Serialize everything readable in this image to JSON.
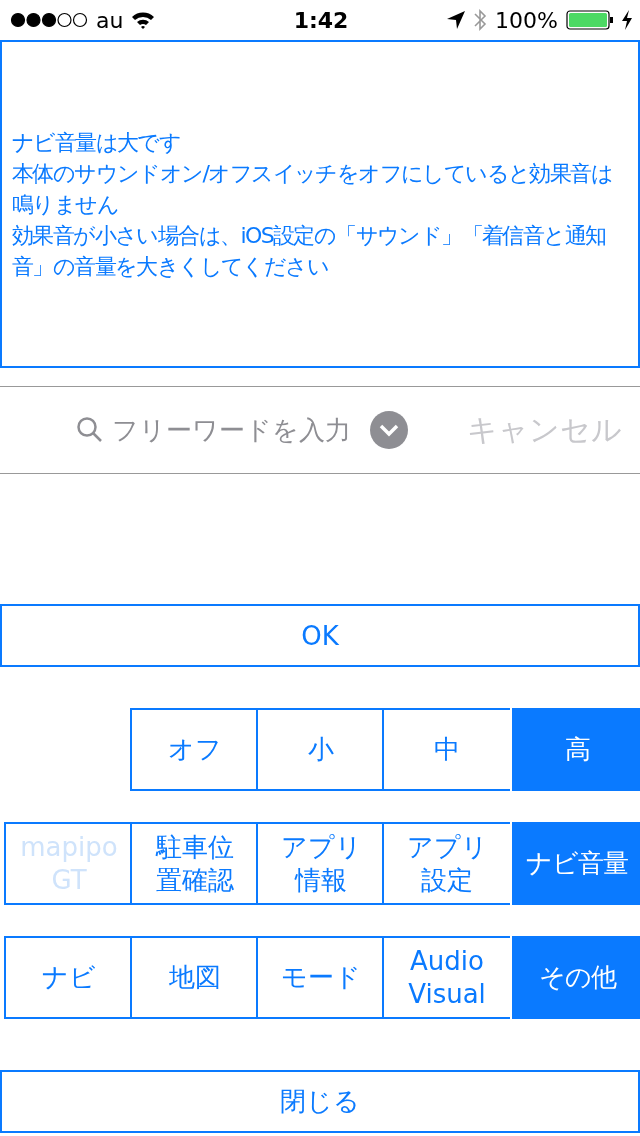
{
  "status_bar": {
    "carrier": "au",
    "time": "1:42",
    "battery": "100%"
  },
  "message": {
    "lines": [
      "ナビ音量は大です",
      "本体のサウンドオン/オフスイッチをオフにしていると効果音は鳴りません",
      "効果音が小さい場合は、iOS設定の「サウンド」「着信音と通知音」の音量を大きくしてください"
    ]
  },
  "search": {
    "placeholder": "フリーワードを入力",
    "cancel": {
      "label": "キャンセル",
      "disabled": true
    }
  },
  "ok_button": "OK",
  "menu_rows": [
    [
      {
        "label": "オフ",
        "selected": false,
        "disabled": false
      },
      {
        "label": "小",
        "selected": false,
        "disabled": false
      },
      {
        "label": "中",
        "selected": false,
        "disabled": false
      },
      {
        "label": "高",
        "selected": true,
        "disabled": false
      }
    ],
    [
      {
        "label": "mapipo\nGT",
        "selected": false,
        "disabled": true
      },
      {
        "label": "駐車位置確認",
        "selected": false,
        "disabled": false
      },
      {
        "label": "アプリ情報",
        "selected": false,
        "disabled": false
      },
      {
        "label": "アプリ設定",
        "selected": false,
        "disabled": false
      },
      {
        "label": "ナビ音量",
        "selected": true,
        "disabled": false
      }
    ],
    [
      {
        "label": "ナビ",
        "selected": false,
        "disabled": false
      },
      {
        "label": "地図",
        "selected": false,
        "disabled": false
      },
      {
        "label": "モード",
        "selected": false,
        "disabled": false
      },
      {
        "label": "Audio\nVisual",
        "selected": false,
        "disabled": false
      },
      {
        "label": "その他",
        "selected": true,
        "disabled": false
      }
    ]
  ],
  "close_button": "閉じる"
}
